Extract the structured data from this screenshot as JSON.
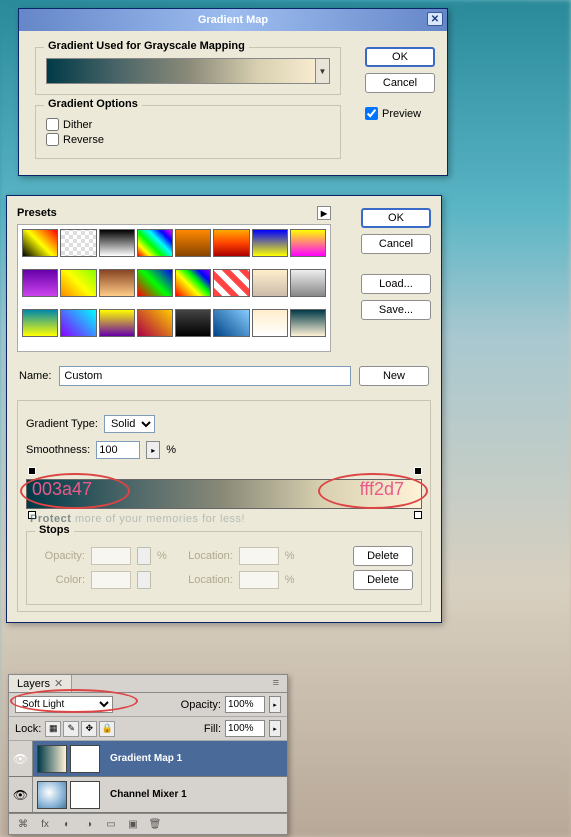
{
  "gmap": {
    "title": "Gradient Map",
    "section1": "Gradient Used for Grayscale Mapping",
    "section2": "Gradient Options",
    "dither": "Dither",
    "reverse": "Reverse",
    "ok": "OK",
    "cancel": "Cancel",
    "preview": "Preview",
    "preview_checked": true
  },
  "gedit": {
    "presets_label": "Presets",
    "ok": "OK",
    "cancel": "Cancel",
    "load": "Load...",
    "save": "Save...",
    "name_label": "Name:",
    "name_value": "Custom",
    "new": "New",
    "gtype_label": "Gradient Type:",
    "gtype_value": "Solid",
    "smooth_label": "Smoothness:",
    "smooth_value": "100",
    "smooth_unit": "%",
    "stops_label": "Stops",
    "opacity_label": "Opacity:",
    "location_label": "Location:",
    "color_label": "Color:",
    "pct": "%",
    "delete": "Delete",
    "hex_left": "003a47",
    "hex_right": "fff2d7"
  },
  "layers": {
    "tab": "Layers",
    "blend_mode": "Soft Light",
    "opacity_label": "Opacity:",
    "opacity_value": "100%",
    "lock_label": "Lock:",
    "fill_label": "Fill:",
    "fill_value": "100%",
    "items": [
      {
        "name": "Gradient Map 1"
      },
      {
        "name": "Channel Mixer 1"
      }
    ]
  },
  "watermark": {
    "strong": "Protect",
    "rest": " more of your memories for less!"
  }
}
